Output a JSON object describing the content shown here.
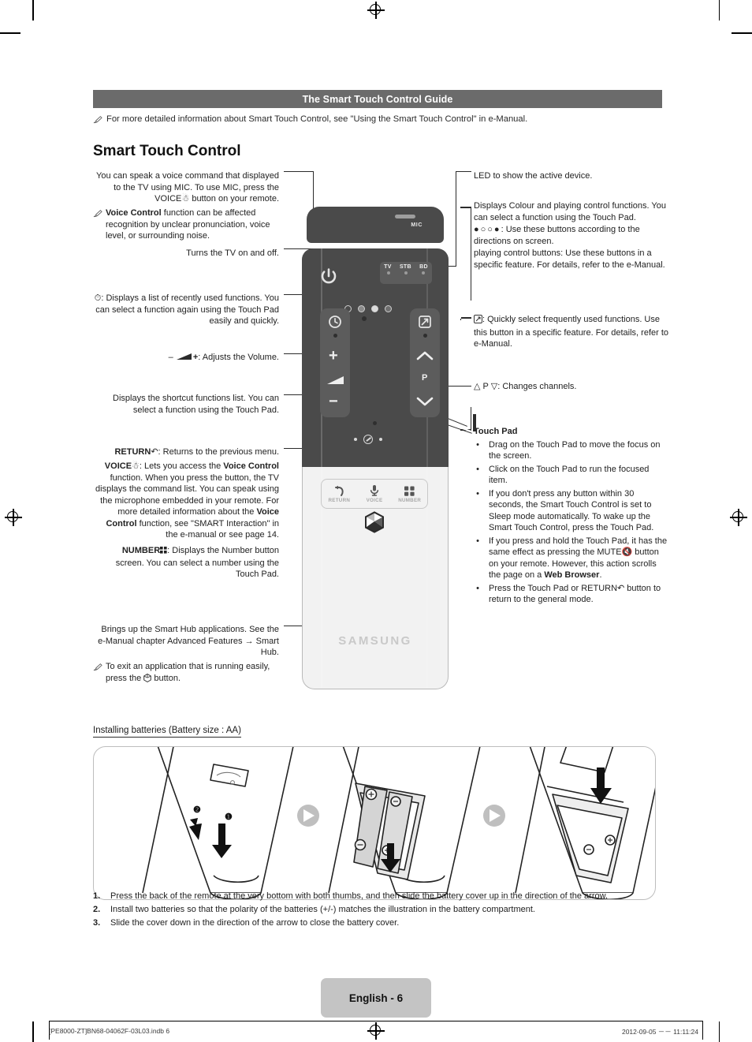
{
  "header": {
    "band_title": "The Smart Touch Control Guide",
    "note": "For more detailed information about Smart Touch Control, see \"Using the Smart Touch Control\" in e-Manual.",
    "heading": "Smart Touch Control"
  },
  "left_callouts": {
    "mic": {
      "line1": "You can speak a voice command that displayed",
      "line2": "to the TV using MIC. To use MIC, press the",
      "line3": "VOICE",
      "line3b": " button on your remote.",
      "note_bold": "Voice Control",
      "note_rest": " function can be affected recognition by unclear pronunciation, voice level, or surrounding noise."
    },
    "power": "Turns the TV on and off.",
    "recent": ": Displays a list of recently used functions. You can select a function again using the Touch Pad easily and quickly.",
    "volume": ": Adjusts the Volume.",
    "volume_minus": "–",
    "volume_plus": "+",
    "shortcut": "Displays the shortcut functions list. You can select a function using the Touch Pad.",
    "return_label": "RETURN",
    "return_rest": ": Returns to the previous menu.",
    "voice_label": "VOICE",
    "voice_rest_1": ": Lets you access the ",
    "voice_bold_1": "Voice Control",
    "voice_rest_2": " function. When you press the button, the TV displays the command list. You can speak using the microphone embedded in your remote. For more detailed information about the ",
    "voice_bold_2": "Voice Control",
    "voice_rest_3": " function, see \"SMART Interaction\" in the e-manual or see page 14.",
    "number_label": "NUMBER",
    "number_rest": ": Displays the Number button screen. You can select a number using the Touch Pad.",
    "hub": "Brings up the Smart Hub applications. See the e-Manual chapter Advanced Features → Smart Hub.",
    "hub_note_1": "To exit an application that is running easily, press the ",
    "hub_note_2": " button."
  },
  "right_callouts": {
    "led": "LED to show the active device.",
    "colour_1": "Displays Colour and playing control functions. You can select a function using the Touch Pad.",
    "colour_2": ": Use these buttons according to the directions on screen.",
    "colour_3": "playing control buttons: Use these buttons in a specific feature. For details, refer to the e-Manual.",
    "shortcut": ": Quickly select frequently used functions. Use this button in a specific feature. For details, refer to e-Manual.",
    "channel_letter": "P",
    "channel": ": Changes channels.",
    "touchpad_title": "Touch Pad",
    "touchpad_bullets": [
      "Drag on the Touch Pad to move the focus on the screen.",
      "Click on the Touch Pad to run the focused item.",
      "If you don't press any button within 30 seconds, the Smart Touch Control is set to Sleep mode automatically. To wake up the Smart Touch Control, press the Touch Pad.",
      "If you press and hold the Touch Pad, it has the same effect as pressing the MUTE",
      "Press the Touch Pad or RETURN"
    ],
    "bullet4_rest_1": " button on your remote. However, this action scrolls the page on a ",
    "bullet4_bold": "Web Browser",
    "bullet4_rest_2": ".",
    "bullet5_rest": " button to return to the general mode.",
    "mute_label": "MUTE",
    "return_label": "RETURN"
  },
  "remote": {
    "mic_label": "MIC",
    "devices": [
      "TV",
      "STB",
      "BD"
    ],
    "brand": "SAMSUNG",
    "buttons": [
      "RETURN",
      "VOICE",
      "NUMBER"
    ],
    "channel_letter": "P",
    "colour_dots": [
      "#4a4a4a",
      "#8a8a8a",
      "#d9d9d9",
      "#6f6f6f"
    ],
    "body_dark": "#4a4a4a",
    "body_light": "#f2f2f2"
  },
  "battery": {
    "title": "Installing batteries (Battery size : AA)",
    "marks": [
      "❶",
      "❷"
    ],
    "steps": [
      {
        "n": "1.",
        "text": "Press the back of the remote at the very bottom with both thumbs, and then slide the battery cover up in the direction of the arrow."
      },
      {
        "n": "2.",
        "text": "Install two batteries so that the polarity of the batteries (+/-) matches the illustration in the battery compartment."
      },
      {
        "n": "3.",
        "text": "Slide the cover down in the direction of the arrow to close the battery cover."
      }
    ]
  },
  "footer": {
    "page_label": "English - 6",
    "left": "[PE8000-ZT]BN68-04062F-03L03.indb   6",
    "right": "2012-09-05   －－ 11:11:24"
  }
}
